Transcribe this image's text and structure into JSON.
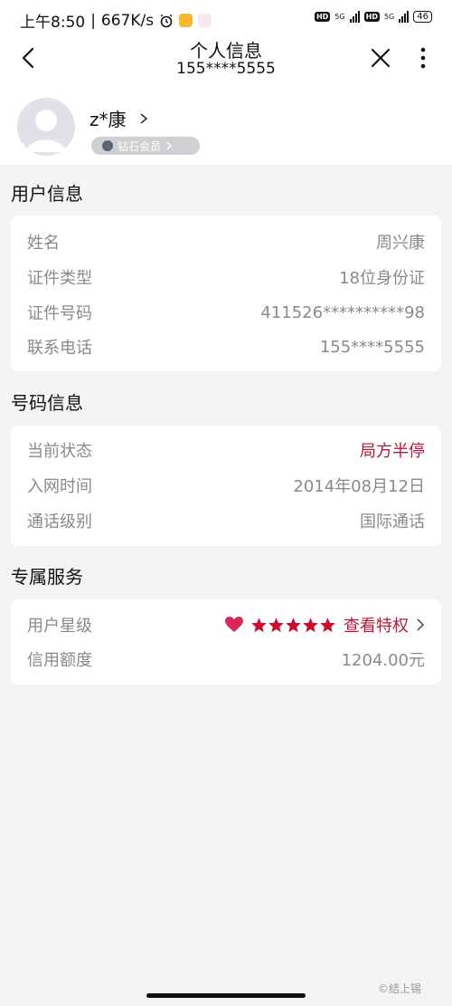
{
  "status_bar": {
    "time": "上午8:50",
    "speed": "667K/s",
    "network_5g_1": "5G",
    "network_5g_2": "5G",
    "hd_1": "HD",
    "hd_2": "HD",
    "battery": "46"
  },
  "header": {
    "title": "个人信息",
    "subtitle": "155****5555"
  },
  "profile": {
    "name": "z*康",
    "badge_label": "钻石会员"
  },
  "user_info": {
    "section_title": "用户信息",
    "rows": [
      {
        "label": "姓名",
        "value": "周兴康"
      },
      {
        "label": "证件类型",
        "value": "18位身份证"
      },
      {
        "label": "证件号码",
        "value": "411526**********98"
      },
      {
        "label": "联系电话",
        "value": "155****5555"
      }
    ]
  },
  "number_info": {
    "section_title": "号码信息",
    "rows": [
      {
        "label": "当前状态",
        "value": "局方半停"
      },
      {
        "label": "入网时间",
        "value": "2014年08月12日"
      },
      {
        "label": "通话级别",
        "value": "国际通话"
      }
    ]
  },
  "exclusive_service": {
    "section_title": "专属服务",
    "star_level_label": "用户星级",
    "star_count": 5,
    "privilege_link": "查看特权",
    "credit_label": "信用额度",
    "credit_value": "1204.00元"
  },
  "colors": {
    "accent_red": "#b8183c",
    "label_gray": "#8a8a8e",
    "page_bg": "#f4f4f6"
  },
  "watermark": "©结上锡"
}
